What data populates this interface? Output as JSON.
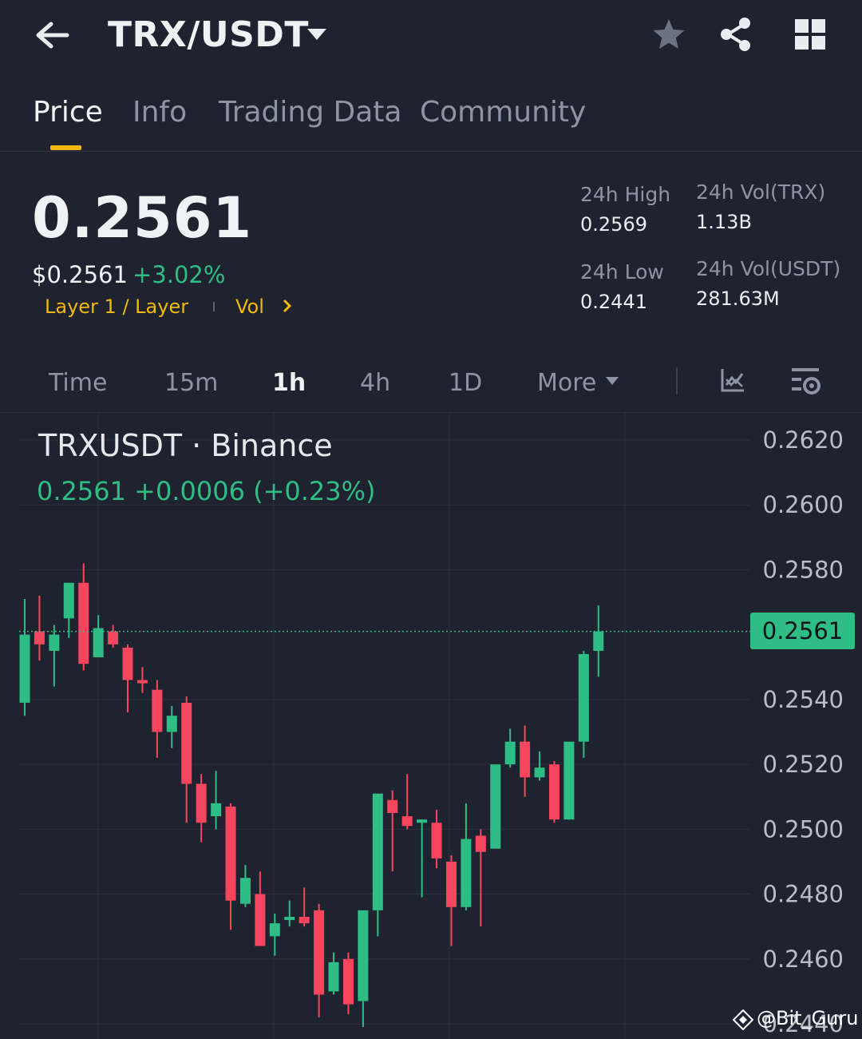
{
  "header": {
    "pair": "TRX/USDT",
    "back_icon": "arrow-left-icon",
    "dropdown_icon": "caret-down-icon",
    "favorite_icon": "star-icon",
    "share_icon": "share-icon",
    "menu_icon": "grid-icon"
  },
  "tabs": [
    {
      "label": "Price",
      "active": true
    },
    {
      "label": "Info",
      "active": false
    },
    {
      "label": "Trading Data",
      "active": false
    },
    {
      "label": "Community",
      "active": false
    }
  ],
  "ticker": {
    "last_price": "0.2561",
    "usd_price": "$0.2561",
    "change_pct": "+3.02%",
    "tag_layer": "Layer 1 / Layer",
    "tag_vol": "Vol",
    "stats": {
      "high_label": "24h High",
      "high_value": "0.2569",
      "low_label": "24h Low",
      "low_value": "0.2441",
      "vol_trx_label": "24h Vol(TRX)",
      "vol_trx_value": "1.13B",
      "vol_usdt_label": "24h Vol(USDT)",
      "vol_usdt_value": "281.63M"
    }
  },
  "intervals": {
    "items": [
      "Time",
      "15m",
      "1h",
      "4h",
      "1D",
      "More"
    ],
    "selected": "1h"
  },
  "colors": {
    "up": "#2ebd85",
    "down": "#f6465d",
    "accent": "#f0b90b",
    "background": "#1f2330"
  },
  "chart_header": {
    "title": "TRXUSDT · Binance",
    "quote": "0.2561  +0.0006 (+0.23%)"
  },
  "chart_data": {
    "type": "candlestick",
    "interval": "1h",
    "y_ticks": [
      "0.2620",
      "0.2600",
      "0.2580",
      "0.2540",
      "0.2520",
      "0.2500",
      "0.2480",
      "0.2460",
      "0.2440"
    ],
    "ylim": [
      0.2432,
      0.264
    ],
    "last_price_label": "0.2561",
    "candles": [
      {
        "o": 0.2539,
        "h": 0.2571,
        "l": 0.2535,
        "c": 0.256
      },
      {
        "o": 0.2561,
        "h": 0.2572,
        "l": 0.2552,
        "c": 0.2557
      },
      {
        "o": 0.2555,
        "h": 0.2563,
        "l": 0.2544,
        "c": 0.256
      },
      {
        "o": 0.2565,
        "h": 0.2572,
        "l": 0.2559,
        "c": 0.2576
      },
      {
        "o": 0.2576,
        "h": 0.2582,
        "l": 0.2549,
        "c": 0.2551
      },
      {
        "o": 0.2553,
        "h": 0.2566,
        "l": 0.2554,
        "c": 0.2562
      },
      {
        "o": 0.2561,
        "h": 0.2563,
        "l": 0.2556,
        "c": 0.2557
      },
      {
        "o": 0.2556,
        "h": 0.2557,
        "l": 0.2536,
        "c": 0.2546
      },
      {
        "o": 0.2546,
        "h": 0.255,
        "l": 0.2542,
        "c": 0.2545
      },
      {
        "o": 0.2543,
        "h": 0.2546,
        "l": 0.2522,
        "c": 0.253
      },
      {
        "o": 0.253,
        "h": 0.2538,
        "l": 0.2525,
        "c": 0.2535
      },
      {
        "o": 0.2539,
        "h": 0.2541,
        "l": 0.2502,
        "c": 0.2514
      },
      {
        "o": 0.2514,
        "h": 0.2517,
        "l": 0.2496,
        "c": 0.2502
      },
      {
        "o": 0.2504,
        "h": 0.2518,
        "l": 0.25,
        "c": 0.2508
      },
      {
        "o": 0.2507,
        "h": 0.2508,
        "l": 0.2469,
        "c": 0.2478
      },
      {
        "o": 0.2477,
        "h": 0.2489,
        "l": 0.2476,
        "c": 0.2485
      },
      {
        "o": 0.248,
        "h": 0.2487,
        "l": 0.2466,
        "c": 0.2464
      },
      {
        "o": 0.2467,
        "h": 0.2474,
        "l": 0.2461,
        "c": 0.2471
      },
      {
        "o": 0.2472,
        "h": 0.2478,
        "l": 0.247,
        "c": 0.2473
      },
      {
        "o": 0.2473,
        "h": 0.2482,
        "l": 0.247,
        "c": 0.2471
      },
      {
        "o": 0.2475,
        "h": 0.2477,
        "l": 0.2442,
        "c": 0.2449
      },
      {
        "o": 0.245,
        "h": 0.2462,
        "l": 0.2449,
        "c": 0.2459
      },
      {
        "o": 0.246,
        "h": 0.2462,
        "l": 0.2443,
        "c": 0.2446
      },
      {
        "o": 0.2447,
        "h": 0.2473,
        "l": 0.2439,
        "c": 0.2475
      },
      {
        "o": 0.2475,
        "h": 0.251,
        "l": 0.2467,
        "c": 0.2511
      },
      {
        "o": 0.2509,
        "h": 0.2512,
        "l": 0.2487,
        "c": 0.2505
      },
      {
        "o": 0.2504,
        "h": 0.2517,
        "l": 0.25,
        "c": 0.2501
      },
      {
        "o": 0.2502,
        "h": 0.2503,
        "l": 0.2479,
        "c": 0.2503
      },
      {
        "o": 0.2502,
        "h": 0.2506,
        "l": 0.2488,
        "c": 0.2491
      },
      {
        "o": 0.249,
        "h": 0.2492,
        "l": 0.2464,
        "c": 0.2476
      },
      {
        "o": 0.2476,
        "h": 0.2508,
        "l": 0.2475,
        "c": 0.2497
      },
      {
        "o": 0.2498,
        "h": 0.25,
        "l": 0.247,
        "c": 0.2493
      },
      {
        "o": 0.2494,
        "h": 0.25,
        "l": 0.2497,
        "c": 0.252
      },
      {
        "o": 0.252,
        "h": 0.2531,
        "l": 0.2519,
        "c": 0.2527
      },
      {
        "o": 0.2527,
        "h": 0.2532,
        "l": 0.251,
        "c": 0.2516
      },
      {
        "o": 0.2516,
        "h": 0.2524,
        "l": 0.2515,
        "c": 0.2519
      },
      {
        "o": 0.252,
        "h": 0.2521,
        "l": 0.2502,
        "c": 0.2503
      },
      {
        "o": 0.2503,
        "h": 0.2524,
        "l": 0.2503,
        "c": 0.2527
      },
      {
        "o": 0.2527,
        "h": 0.2555,
        "l": 0.2522,
        "c": 0.2554
      },
      {
        "o": 0.2555,
        "h": 0.2569,
        "l": 0.2547,
        "c": 0.2561
      }
    ]
  },
  "watermark": {
    "text": "@Bit_Guru",
    "icon": "binance-diamond-icon"
  }
}
